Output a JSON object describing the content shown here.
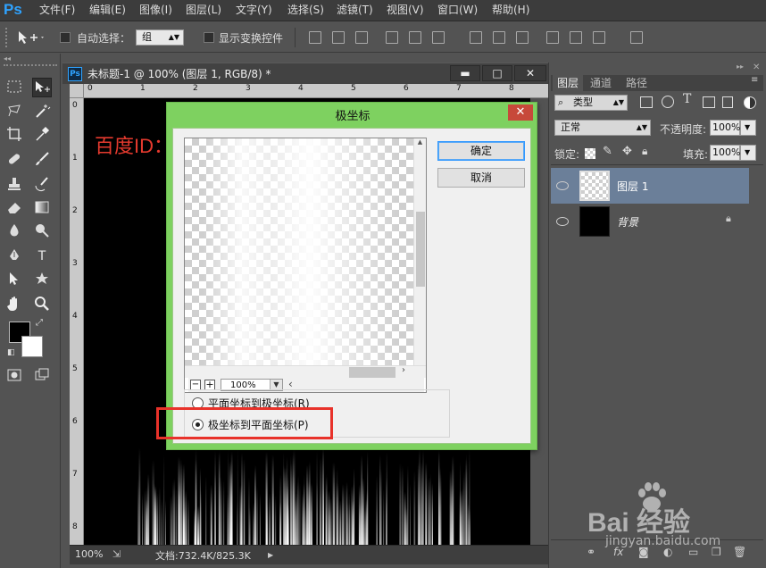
{
  "app": {
    "logo": "Ps"
  },
  "menu": [
    "文件(F)",
    "编辑(E)",
    "图像(I)",
    "图层(L)",
    "文字(Y)",
    "选择(S)",
    "滤镜(T)",
    "视图(V)",
    "窗口(W)",
    "帮助(H)"
  ],
  "options": {
    "auto_select_label": "自动选择：",
    "auto_select_value": "组",
    "show_transform_label": "显示变换控件"
  },
  "document": {
    "title": "未标题-1 @ 100% (图层 1, RGB/8) *",
    "ruler_h": [
      "0",
      "1",
      "2",
      "3",
      "4",
      "5",
      "6",
      "7",
      "8"
    ],
    "ruler_v": [
      "0",
      "1",
      "2",
      "3",
      "4",
      "5",
      "6",
      "7",
      "8"
    ],
    "watermark": "百度ID：sunnyMelody夏",
    "zoom": "100%",
    "doc_info": "文档:732.4K/825.3K",
    "title_btn_min": "▬",
    "title_btn_max": "□",
    "title_btn_close": "✕"
  },
  "dialog": {
    "title": "极坐标",
    "close": "✕",
    "ok_label": "确定",
    "cancel_label": "取消",
    "zoom": "100%",
    "zoom_minus": "−",
    "zoom_plus": "+",
    "option1": "平面坐标到极坐标(R)",
    "option2": "极坐标到平面坐标(P)",
    "selected_option": 2
  },
  "layers_panel": {
    "tabs": [
      "图层",
      "通道",
      "路径"
    ],
    "filter": "类型",
    "blend_mode": "正常",
    "opacity_label": "不透明度:",
    "opacity": "100%",
    "lock_label": "锁定:",
    "fill_label": "填充:",
    "fill": "100%",
    "layers": [
      {
        "name": "图层 1",
        "selected": true
      },
      {
        "name": "背景",
        "locked": true
      }
    ]
  },
  "baidu": {
    "logo_text": "Bai 经验",
    "url": "jingyan.baidu.com"
  },
  "colors": {
    "accent_green": "#7ed160",
    "highlight_red": "#e8322a",
    "watermark_red": "#e53a2e",
    "layer_selected": "#6b7f99"
  }
}
